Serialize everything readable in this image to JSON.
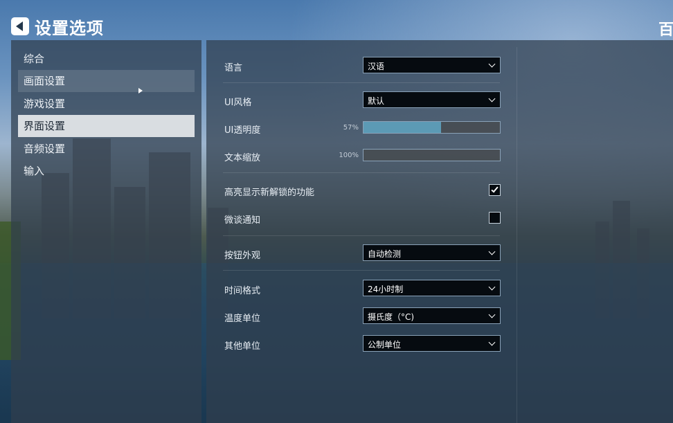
{
  "header": {
    "title": "设置选项",
    "right_title": "百"
  },
  "sidebar": {
    "items": [
      {
        "label": "综合"
      },
      {
        "label": "画面设置"
      },
      {
        "label": "游戏设置"
      },
      {
        "label": "界面设置"
      },
      {
        "label": "音频设置"
      },
      {
        "label": "输入"
      }
    ],
    "hover_index": 1,
    "active_index": 3
  },
  "settings": {
    "language": {
      "label": "语言",
      "value": "汉语"
    },
    "ui_style": {
      "label": "UI风格",
      "value": "默认"
    },
    "ui_opacity": {
      "label": "UI透明度",
      "percent_text": "57%",
      "fraction": 0.57
    },
    "text_scale": {
      "label": "文本缩放",
      "percent_text": "100%",
      "fraction": 0.0
    },
    "highlight_unlocks": {
      "label": "高亮显示新解锁的功能",
      "checked": true
    },
    "chirper_notifications": {
      "label": "微谈通知",
      "checked": false
    },
    "button_appearance": {
      "label": "按钮外观",
      "value": "自动检测"
    },
    "time_format": {
      "label": "时间格式",
      "value": "24小时制"
    },
    "temperature_unit": {
      "label": "温度单位",
      "value": "摄氏度（°C)"
    },
    "other_units": {
      "label": "其他单位",
      "value": "公制单位"
    }
  },
  "colors": {
    "slider_fill": "#5c9ab5",
    "active_tab_bg": "#d9dde1",
    "dropdown_border": "#8aa2b8"
  }
}
